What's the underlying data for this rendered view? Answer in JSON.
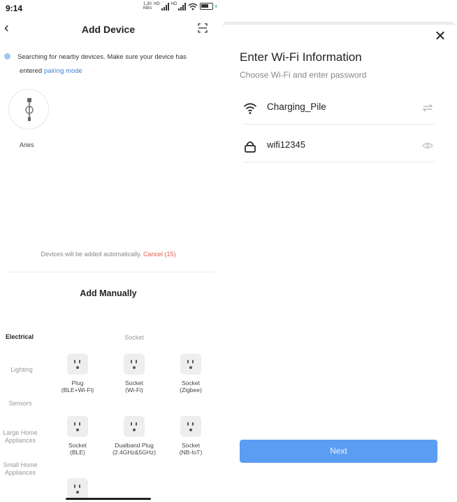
{
  "status_bar": {
    "time": "9:14",
    "net_speed_value": "1.30",
    "net_speed_unit": "KB/s",
    "signal_label": "HD"
  },
  "add_device": {
    "title": "Add Device",
    "searching_text": "Searching for nearby devices. Make sure your device has",
    "searching_text_2": "entered",
    "pairing_link": "pairing mode",
    "found_device_name": "Aries",
    "auto_note": "Devices will be added automatically.",
    "cancel_label": "Cancel (15)",
    "manual_title": "Add Manually",
    "categories": [
      {
        "label": "Electrical",
        "active": true
      },
      {
        "label": "Lighting",
        "active": false
      },
      {
        "label": "Sensors",
        "active": false
      },
      {
        "label": "Large Home Appliances",
        "active": false
      },
      {
        "label": "Small Home Appliances",
        "active": false
      }
    ],
    "section_title": "Socket",
    "products": [
      {
        "line1": "Plug",
        "line2": "(BLE+Wi-Fi)"
      },
      {
        "line1": "Socket",
        "line2": "(Wi-Fi)"
      },
      {
        "line1": "Socket",
        "line2": "(Zigbee)"
      },
      {
        "line1": "Socket",
        "line2": "(BLE)"
      },
      {
        "line1": "Dualband Plug",
        "line2": "(2.4GHz&5GHz)"
      },
      {
        "line1": "Socket",
        "line2": "(NB-IoT)"
      },
      {
        "line1": "",
        "line2": ""
      }
    ]
  },
  "wifi_sheet": {
    "title": "Enter Wi-Fi Information",
    "subtitle": "Choose Wi-Fi and enter password",
    "ssid": "Charging_Pile",
    "password": "wifi12345",
    "next_label": "Next",
    "accent_color": "#5b9df2"
  },
  "icons": {
    "back": "back-chevron-icon",
    "scan": "scan-icon",
    "close": "close-icon",
    "wifi": "wifi-icon",
    "lock": "lock-icon",
    "swap": "swap-icon",
    "eye": "eye-icon",
    "socket": "socket-icon"
  }
}
